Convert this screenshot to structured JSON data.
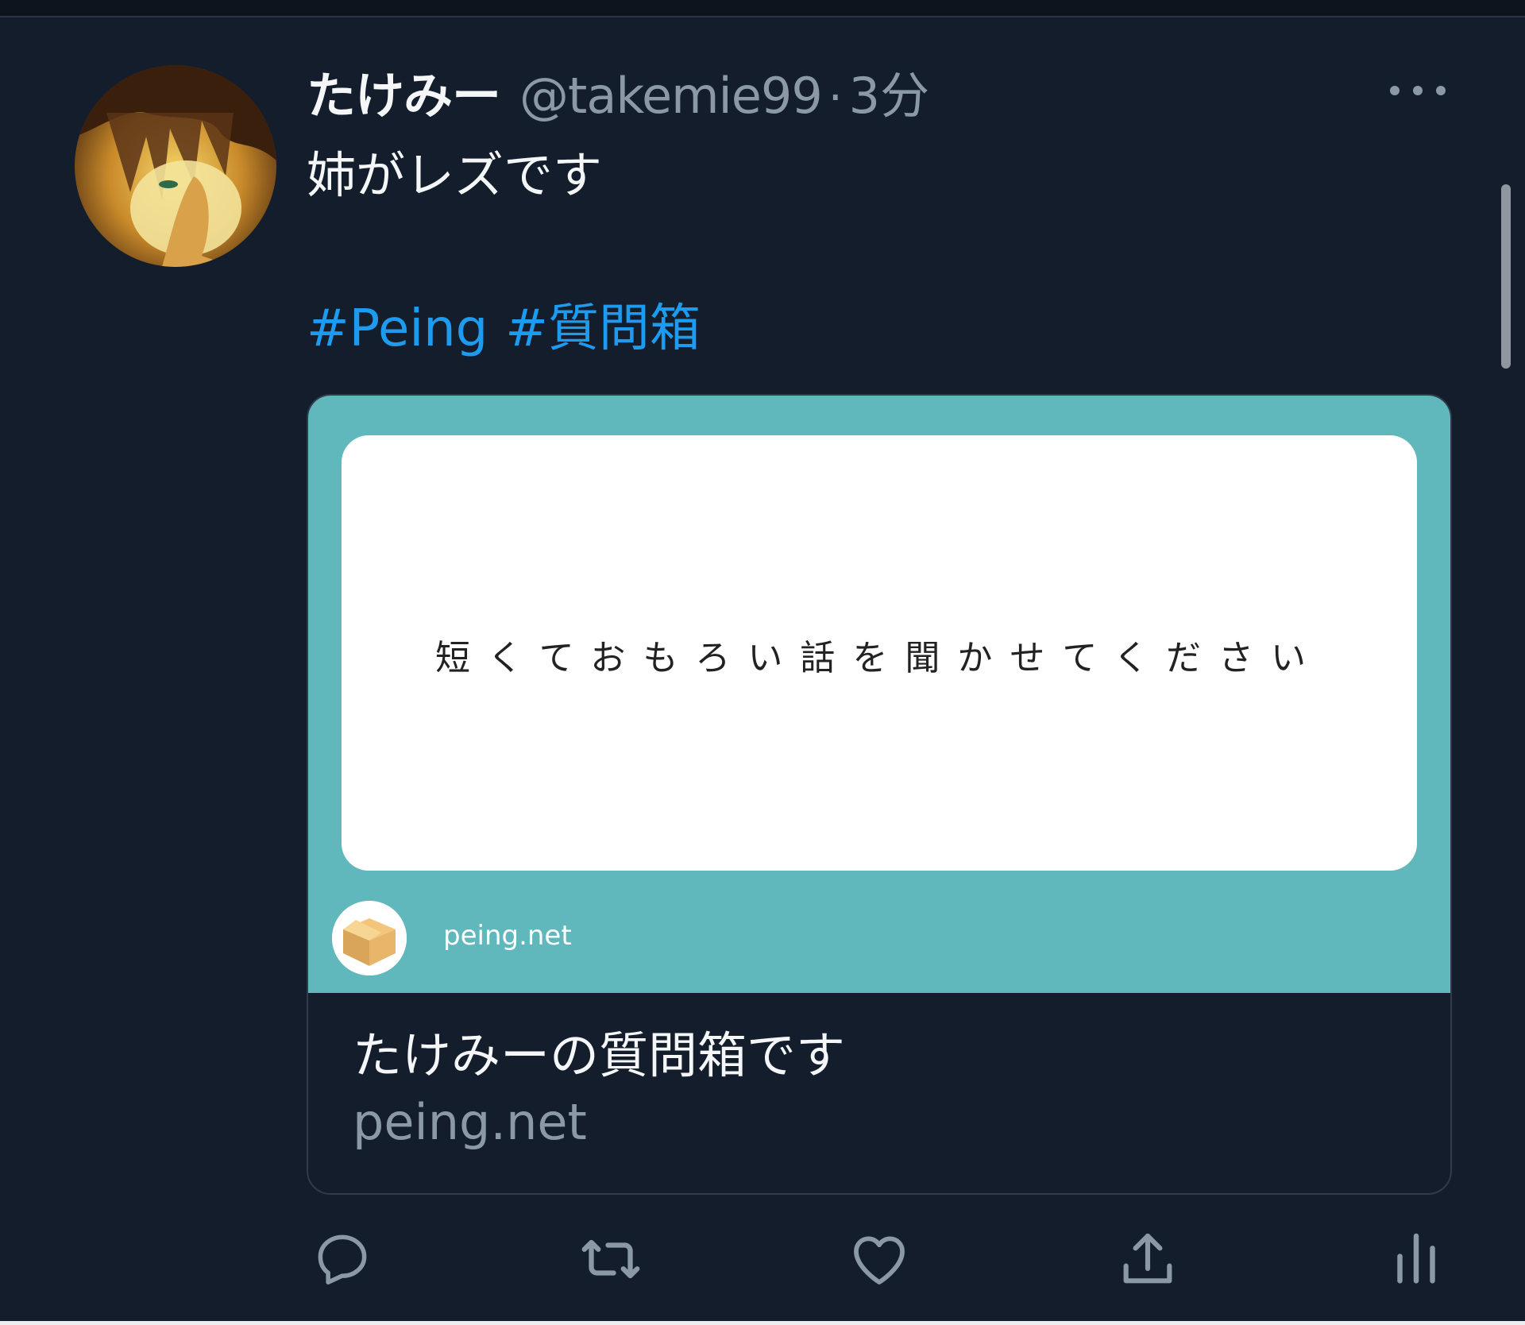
{
  "tweet": {
    "display_name": "たけみー",
    "handle": "@takemie99",
    "separator": "·",
    "time": "3分",
    "text": "姉がレズです",
    "hashtags": [
      "#Peing",
      "#質問箱"
    ]
  },
  "card": {
    "question": "短くておもろい話を聞かせてください",
    "site_name": "peing.net",
    "title": "たけみーの質問箱です",
    "domain": "peing.net"
  },
  "icons": {
    "more": "more-horizontal-icon",
    "reply": "reply-icon",
    "retweet": "retweet-icon",
    "like": "heart-icon",
    "share": "share-icon",
    "analytics": "analytics-icon"
  },
  "colors": {
    "background": "#141d2b",
    "text_primary": "#f4f6f8",
    "text_secondary": "#8b98a5",
    "link": "#1d9bf0",
    "card_accent": "#60b8bc"
  }
}
